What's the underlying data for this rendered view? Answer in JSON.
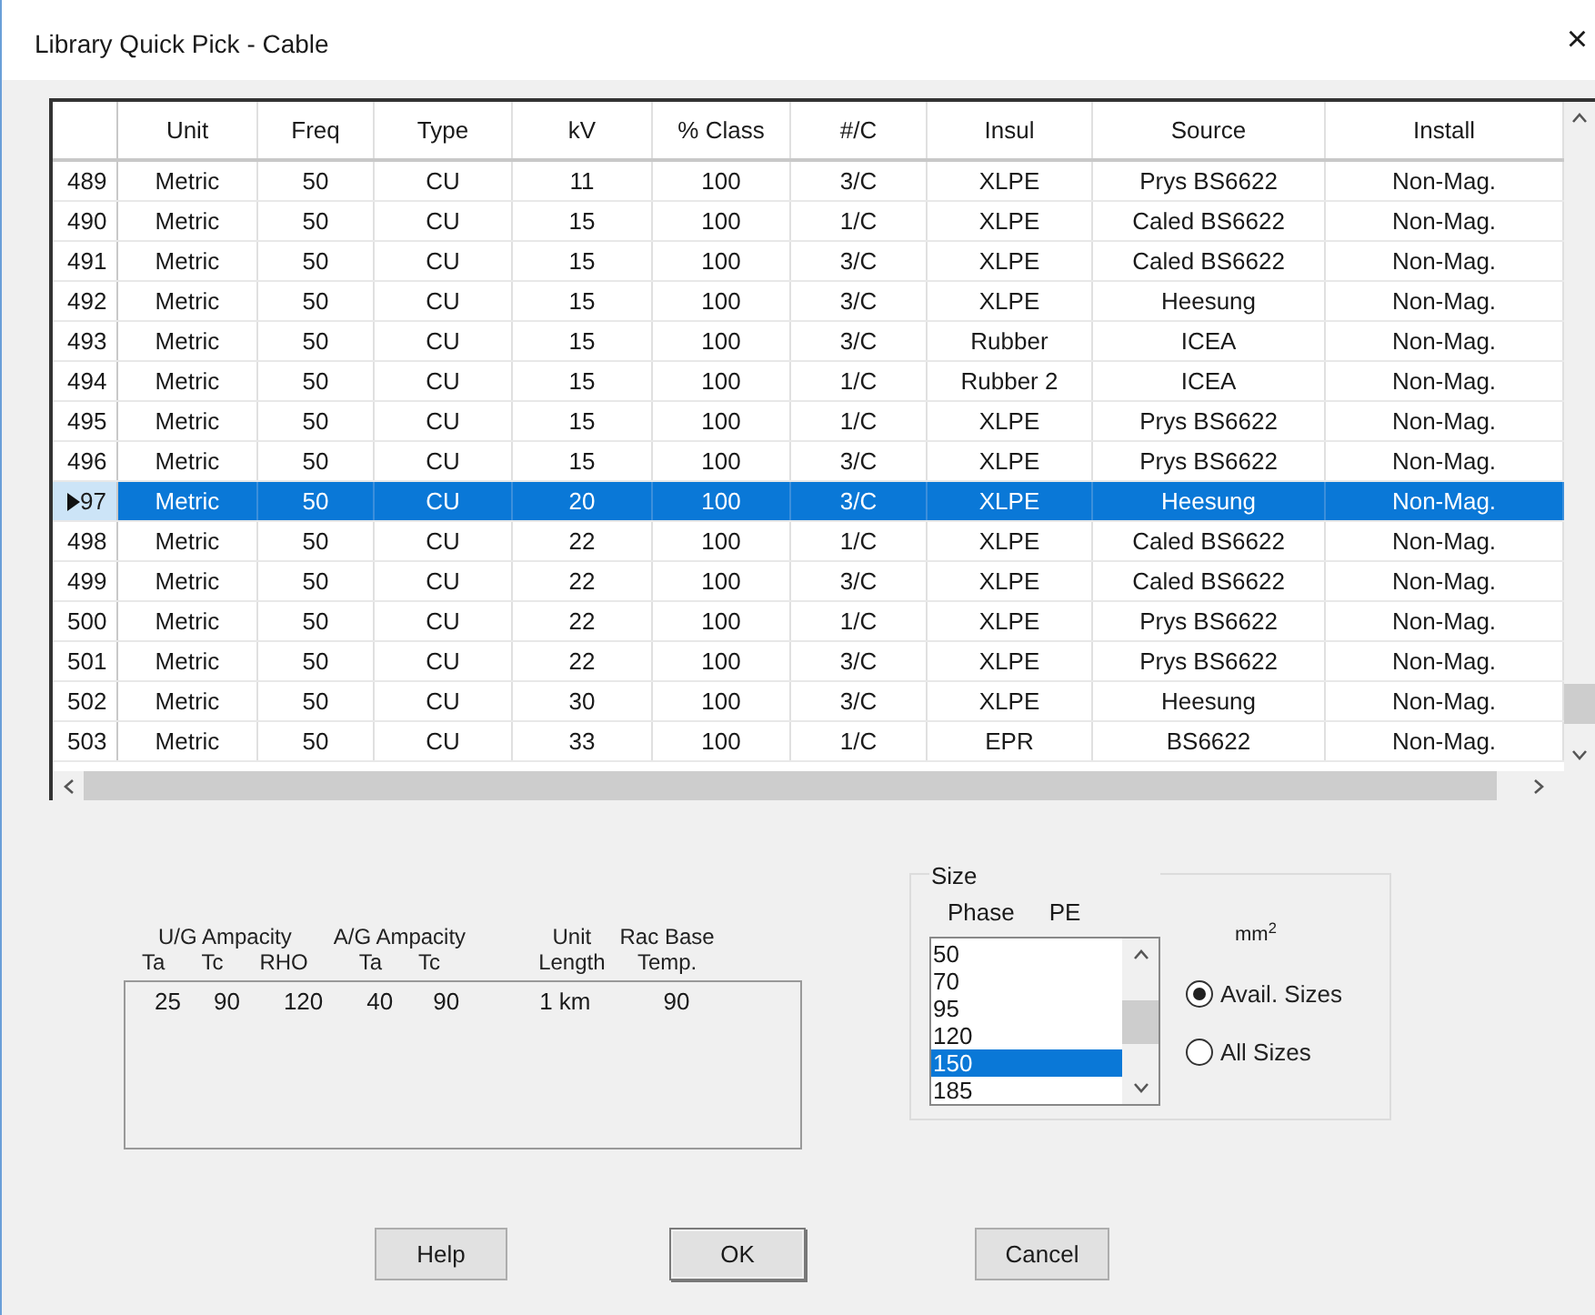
{
  "window": {
    "title": "Library Quick Pick - Cable",
    "close": "×"
  },
  "table": {
    "columns": [
      "Unit",
      "Freq",
      "Type",
      "kV",
      "% Class",
      "#/C",
      "Insul",
      "Source",
      "Install"
    ],
    "rows": [
      {
        "number": "489",
        "cells": [
          "Metric",
          "50",
          "CU",
          "11",
          "100",
          "3/C",
          "XLPE",
          "Prys BS6622",
          "Non-Mag."
        ],
        "selected": false
      },
      {
        "number": "490",
        "cells": [
          "Metric",
          "50",
          "CU",
          "15",
          "100",
          "1/C",
          "XLPE",
          "Caled BS6622",
          "Non-Mag."
        ],
        "selected": false
      },
      {
        "number": "491",
        "cells": [
          "Metric",
          "50",
          "CU",
          "15",
          "100",
          "3/C",
          "XLPE",
          "Caled BS6622",
          "Non-Mag."
        ],
        "selected": false
      },
      {
        "number": "492",
        "cells": [
          "Metric",
          "50",
          "CU",
          "15",
          "100",
          "3/C",
          "XLPE",
          "Heesung",
          "Non-Mag."
        ],
        "selected": false
      },
      {
        "number": "493",
        "cells": [
          "Metric",
          "50",
          "CU",
          "15",
          "100",
          "3/C",
          "Rubber",
          "ICEA",
          "Non-Mag."
        ],
        "selected": false
      },
      {
        "number": "494",
        "cells": [
          "Metric",
          "50",
          "CU",
          "15",
          "100",
          "1/C",
          "Rubber 2",
          "ICEA",
          "Non-Mag."
        ],
        "selected": false
      },
      {
        "number": "495",
        "cells": [
          "Metric",
          "50",
          "CU",
          "15",
          "100",
          "1/C",
          "XLPE",
          "Prys BS6622",
          "Non-Mag."
        ],
        "selected": false
      },
      {
        "number": "496",
        "cells": [
          "Metric",
          "50",
          "CU",
          "15",
          "100",
          "3/C",
          "XLPE",
          "Prys BS6622",
          "Non-Mag."
        ],
        "selected": false
      },
      {
        "number": "97",
        "cells": [
          "Metric",
          "50",
          "CU",
          "20",
          "100",
          "3/C",
          "XLPE",
          "Heesung",
          "Non-Mag."
        ],
        "selected": true
      },
      {
        "number": "498",
        "cells": [
          "Metric",
          "50",
          "CU",
          "22",
          "100",
          "1/C",
          "XLPE",
          "Caled BS6622",
          "Non-Mag."
        ],
        "selected": false
      },
      {
        "number": "499",
        "cells": [
          "Metric",
          "50",
          "CU",
          "22",
          "100",
          "3/C",
          "XLPE",
          "Caled BS6622",
          "Non-Mag."
        ],
        "selected": false
      },
      {
        "number": "500",
        "cells": [
          "Metric",
          "50",
          "CU",
          "22",
          "100",
          "1/C",
          "XLPE",
          "Prys BS6622",
          "Non-Mag."
        ],
        "selected": false
      },
      {
        "number": "501",
        "cells": [
          "Metric",
          "50",
          "CU",
          "22",
          "100",
          "3/C",
          "XLPE",
          "Prys BS6622",
          "Non-Mag."
        ],
        "selected": false
      },
      {
        "number": "502",
        "cells": [
          "Metric",
          "50",
          "CU",
          "30",
          "100",
          "3/C",
          "XLPE",
          "Heesung",
          "Non-Mag."
        ],
        "selected": false
      },
      {
        "number": "503",
        "cells": [
          "Metric",
          "50",
          "CU",
          "33",
          "100",
          "1/C",
          "EPR",
          "BS6622",
          "Non-Mag."
        ],
        "selected": false
      }
    ]
  },
  "details": {
    "groups": [
      {
        "title": "U/G Ampacity",
        "columns": [
          {
            "label": "Ta",
            "value": "25"
          },
          {
            "label": "Tc",
            "value": "90"
          },
          {
            "label": "RHO",
            "value": "120"
          }
        ]
      },
      {
        "title": "A/G Ampacity",
        "columns": [
          {
            "label": "Ta",
            "value": "40"
          },
          {
            "label": "Tc",
            "value": "90"
          }
        ]
      }
    ],
    "unit_length": {
      "label": "Unit\nLength",
      "value": "1 km"
    },
    "rac_base_temp": {
      "label": "Rac Base\nTemp.",
      "value": "90"
    }
  },
  "size": {
    "title": "Size",
    "phase_label": "Phase",
    "pe_label": "PE",
    "unit": "mm$^{2}$",
    "items": [
      {
        "label": "50",
        "selected": false
      },
      {
        "label": "70",
        "selected": false
      },
      {
        "label": "95",
        "selected": false
      },
      {
        "label": "120",
        "selected": false
      },
      {
        "label": "150",
        "selected": true
      },
      {
        "label": "185",
        "selected": false
      }
    ],
    "options": [
      {
        "label": "Avail. Sizes",
        "selected": true
      },
      {
        "label": "All Sizes",
        "selected": false
      }
    ]
  },
  "buttons": [
    "Help",
    "OK",
    "Cancel"
  ]
}
